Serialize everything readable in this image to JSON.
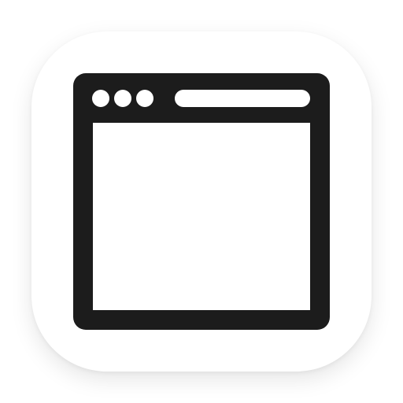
{
  "icon": {
    "name": "browser-window-icon",
    "tile_color": "#ffffff",
    "glyph_color": "#1c1c1c",
    "content_color": "#ffffff"
  }
}
